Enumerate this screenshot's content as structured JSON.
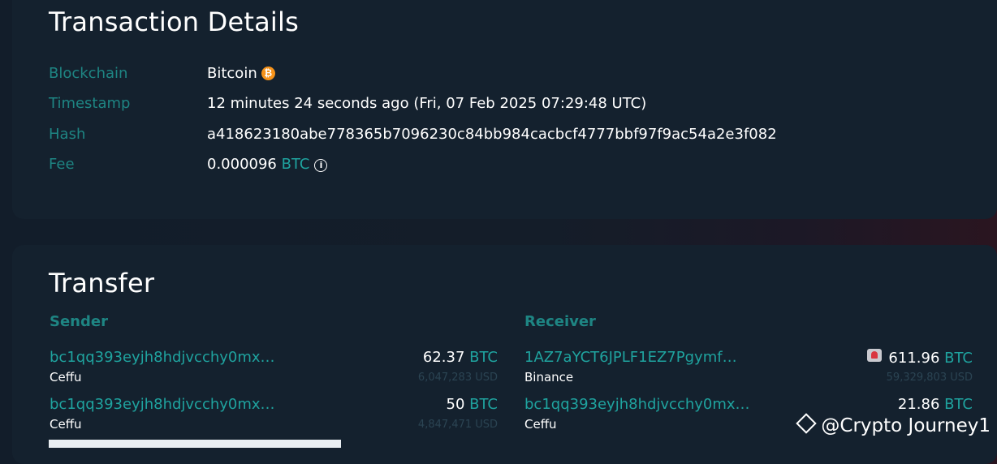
{
  "details": {
    "title": "Transaction Details",
    "blockchain_label": "Blockchain",
    "blockchain_value": "Bitcoin",
    "blockchain_icon": "bitcoin-icon",
    "timestamp_label": "Timestamp",
    "timestamp_value": "12 minutes 24 seconds ago (Fri, 07 Feb 2025 07:29:48 UTC)",
    "hash_label": "Hash",
    "hash_value": "a418623180abe778365b7096230c84bb984cacbcf4777bbf97f9ac54a2e3f082",
    "fee_label": "Fee",
    "fee_amount": "0.000096",
    "fee_unit": "BTC",
    "fee_icon": "info-icon"
  },
  "transfer": {
    "title": "Transfer",
    "sender_label": "Sender",
    "receiver_label": "Receiver",
    "senders": [
      {
        "address": "bc1qq393eyjh8hdjvcchy0mx…",
        "owner": "Ceffu",
        "amount": "62.37",
        "unit": "BTC",
        "usd": "6,047,283 USD"
      },
      {
        "address": "bc1qq393eyjh8hdjvcchy0mx…",
        "owner": "Ceffu",
        "amount": "50",
        "unit": "BTC",
        "usd": "4,847,471 USD"
      }
    ],
    "receivers": [
      {
        "address": "1AZ7aYCT6JPLF1EZ7Pgymf…",
        "owner": "Binance",
        "amount": "611.96",
        "unit": "BTC",
        "usd": "59,329,803 USD",
        "icon": "alert-siren-icon"
      },
      {
        "address": "bc1qq393eyjh8hdjvcchy0mx…",
        "owner": "Ceffu",
        "amount": "21.86",
        "unit": "BTC",
        "usd": ""
      }
    ]
  },
  "watermark": "@Crypto Journey1",
  "colors": {
    "accent": "#1fa39f",
    "label": "#1e8583",
    "card": "#14212e",
    "bitcoin": "#f7931a"
  }
}
